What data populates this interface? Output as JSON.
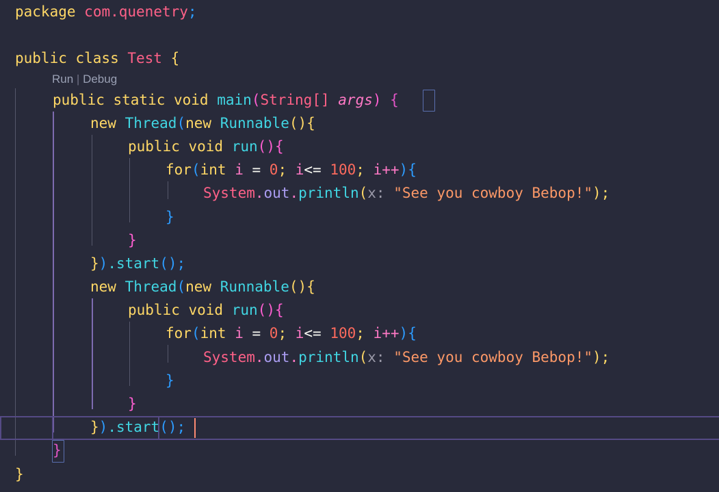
{
  "editor": {
    "language": "java",
    "background_color": "#282a3a",
    "font_size_px": 21,
    "line_height_px": 34.2,
    "cursor_color": "#fc8a72",
    "current_line_border_color": "#554a85",
    "indent_guide_color": "#55576b",
    "active_indent_guide_color": "#7e6bb0",
    "match_brace_border_color": "#5a6faf"
  },
  "codelens": {
    "run_label": "Run",
    "separator": " | ",
    "debug_label": "Debug"
  },
  "code": {
    "line01": {
      "kw_package": "package",
      "space": " ",
      "pkg_name": "com.quenetry",
      "semi": ";"
    },
    "line03": {
      "kw_public_class": "public class",
      "space": " ",
      "class_name": "Test",
      "brace": " {"
    },
    "line05": {
      "kw_modifiers": "public static void",
      "space": " ",
      "method_name": "main",
      "paren_open": "(",
      "param_type": "String[]",
      "space2": " ",
      "param_name": "args",
      "paren_close": ")",
      "space3": " ",
      "brace": "{"
    },
    "line06": {
      "kw_new": "new",
      "space": " ",
      "type_thread": "Thread",
      "paren_open": "(",
      "kw_new2": "new",
      "space2": " ",
      "type_runnable": "Runnable",
      "parens": "()",
      "brace": "{"
    },
    "line07": {
      "kw": "public void",
      "space": " ",
      "method_name": "run",
      "parens": "()",
      "brace": "{"
    },
    "line08": {
      "kw_for": "for",
      "paren_open": "(",
      "kw_int": "int",
      "space": " ",
      "var_i": "i",
      "eq": " = ",
      "zero": "0",
      "semi1": "; ",
      "var_i2": "i",
      "op_lte": "<=",
      "space2": " ",
      "hundred": "100",
      "semi2": "; ",
      "var_i3": "i",
      "incr": "++",
      "paren_close": ")",
      "brace": "{"
    },
    "line09": {
      "obj_system": "System",
      "dot1": ".",
      "field_out": "out",
      "dot2": ".",
      "method_println": "println",
      "paren_open": "(",
      "param_hint": "x: ",
      "string": "\"See you cowboy Bebop!\"",
      "paren_close": ")",
      "semi": ";"
    },
    "line10_close_for": "}",
    "line11_close_run": "}",
    "line12_start": {
      "brace": "}",
      "paren_close": ")",
      "dot": ".",
      "method_start": "start",
      "parens": "()",
      "semi": ";"
    },
    "line19_close_main": "}",
    "line20_close_class": "}"
  }
}
